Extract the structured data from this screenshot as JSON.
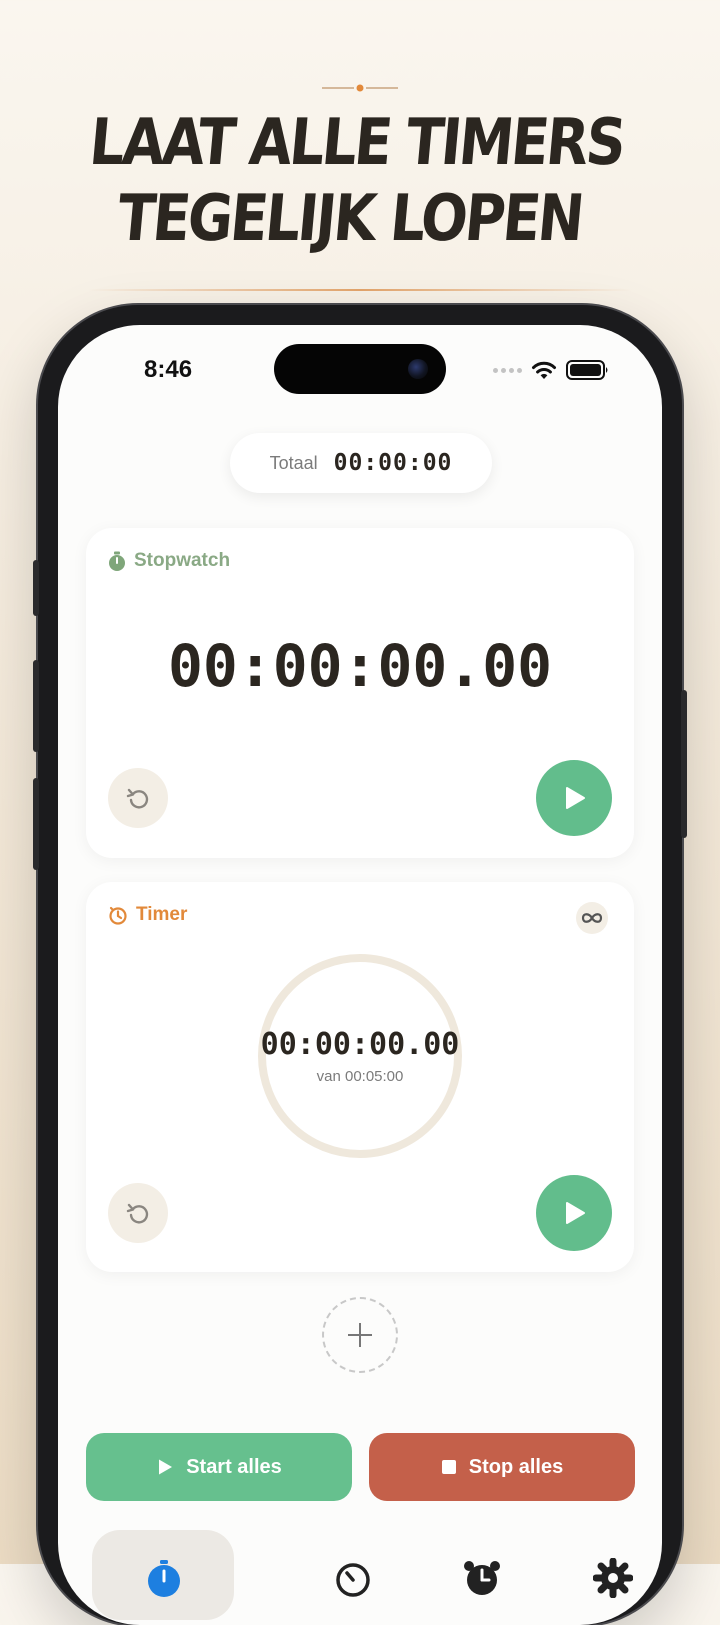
{
  "headline": {
    "line1": "LAAT ALLE TIMERS",
    "line2": "TEGELIJK LOPEN"
  },
  "status_bar": {
    "time": "8:46",
    "icons": [
      "signal-dots-icon",
      "wifi-icon",
      "battery-icon"
    ]
  },
  "total": {
    "label": "Totaal",
    "value": "00:00:00"
  },
  "stopwatch_card": {
    "title": "Stopwatch",
    "title_color": "#8aa985",
    "time": "00:00:00.00",
    "icon": "stopwatch-icon"
  },
  "timer_card": {
    "title": "Timer",
    "title_color": "#e2893a",
    "time": "00:00:00.00",
    "subtitle": "van 00:05:00",
    "icon": "timer-icon",
    "repeat_icon": "infinity-icon",
    "progress": 0
  },
  "actions": {
    "start_all": "Start alles",
    "stop_all": "Stop alles",
    "start_color": "#66c08e",
    "stop_color": "#c4604a"
  },
  "tabs": [
    {
      "icon": "stopwatch-tab-icon",
      "active": true
    },
    {
      "icon": "timer-tab-icon",
      "active": false
    },
    {
      "icon": "alarm-tab-icon",
      "active": false
    },
    {
      "icon": "settings-tab-icon",
      "active": false
    }
  ],
  "colors": {
    "accent_green": "#62bd8c",
    "dark_text": "#2b2620",
    "active_tab_blue": "#1d7fe0"
  }
}
